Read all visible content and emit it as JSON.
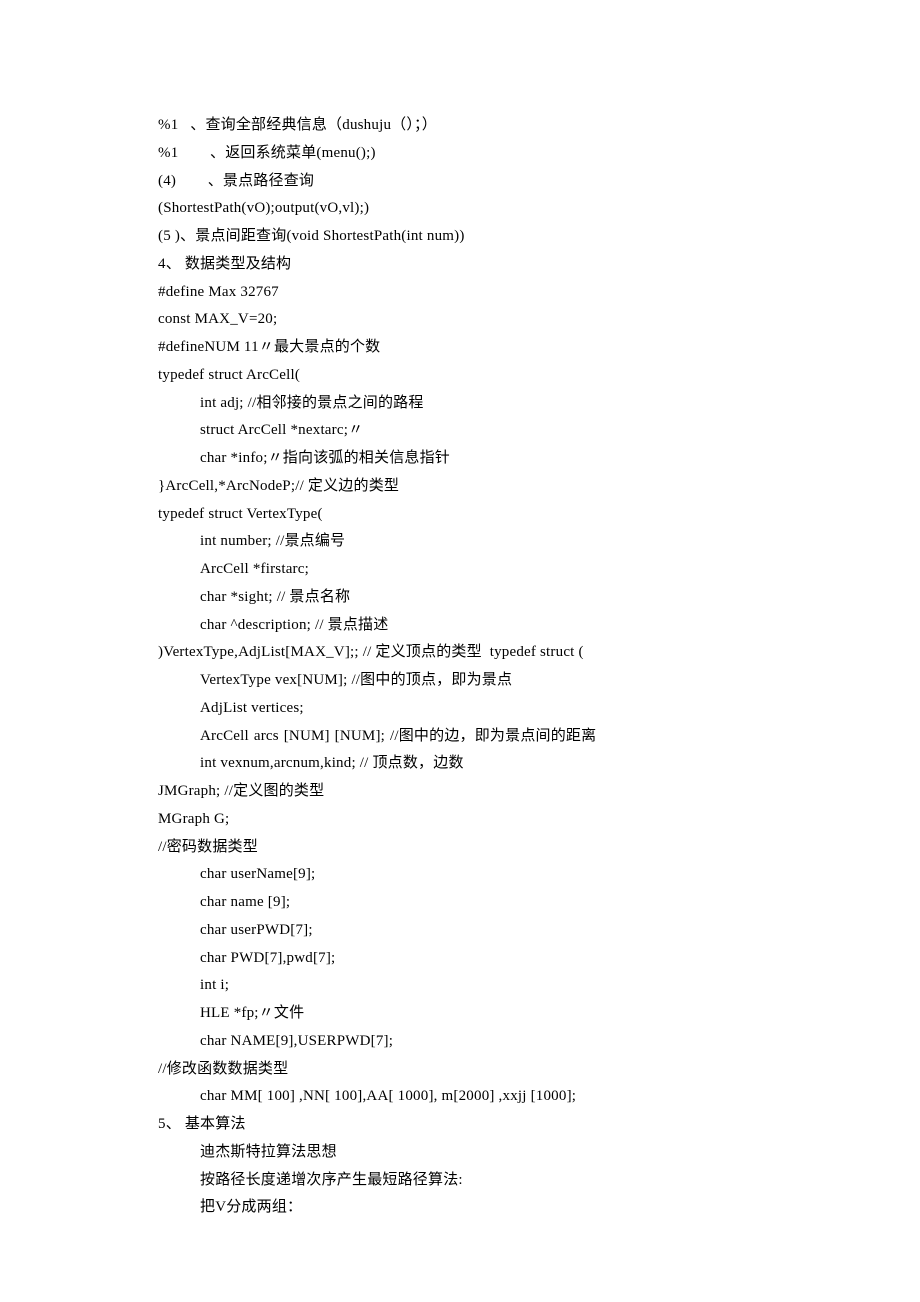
{
  "lines": [
    {
      "cls": "line",
      "text": "%1   、查询全部经典信息（dushuju（）；）"
    },
    {
      "cls": "line",
      "text": "%1        、返回系统菜单(menu();)"
    },
    {
      "cls": "line",
      "text": "(4)        、景点路径查询"
    },
    {
      "cls": "line",
      "text": "(ShortestPath(vO);output(vO,vl);)"
    },
    {
      "cls": "line",
      "text": "(5 )、景点间距查询(void ShortestPath(int num))"
    },
    {
      "cls": "line",
      "text": "4、 数据类型及结构"
    },
    {
      "cls": "line",
      "text": "#define Max 32767"
    },
    {
      "cls": "line",
      "text": "const MAX_V=20;"
    },
    {
      "cls": "line",
      "text": "#defineNUM 11〃最大景点的个数"
    },
    {
      "cls": "line",
      "text": "typedef struct ArcCell("
    },
    {
      "cls": "line indent1",
      "text": "int adj; //相邻接的景点之间的路程"
    },
    {
      "cls": "line indent1",
      "text": "struct ArcCell *nextarc;〃"
    },
    {
      "cls": "line indent1",
      "text": "char *info;〃指向该弧的相关信息指针"
    },
    {
      "cls": "line",
      "text": "}ArcCell,*ArcNodeP;// 定义边的类型"
    },
    {
      "cls": "line",
      "text": "typedef struct VertexType("
    },
    {
      "cls": "line indent1",
      "text": "int number; //景点编号"
    },
    {
      "cls": "line indent1",
      "text": "ArcCell *firstarc;"
    },
    {
      "cls": "line indent1",
      "text": "char *sight; // 景点名称"
    },
    {
      "cls": "line indent1",
      "text": "char ^description; // 景点描述"
    },
    {
      "cls": "line",
      "text": ")VertexType,AdjList[MAX_V];; // 定义顶点的类型  typedef struct ("
    },
    {
      "cls": "line indent1",
      "text": "VertexType vex[NUM]; //图中的顶点，即为景点"
    },
    {
      "cls": "line indent1",
      "text": "AdjList vertices;"
    },
    {
      "cls": "line indent1 widel",
      "text": "ArcCell arcs [NUM] [NUM]; //图中的边，即为景点间的距离"
    },
    {
      "cls": "line indent1",
      "text": "int vexnum,arcnum,kind; // 顶点数，边数"
    },
    {
      "cls": "line",
      "text": "JMGraph; //定义图的类型"
    },
    {
      "cls": "line",
      "text": "MGraph G;"
    },
    {
      "cls": "line",
      "text": "//密码数据类型"
    },
    {
      "cls": "line indent1",
      "text": "char userName[9];"
    },
    {
      "cls": "line indent1",
      "text": "char name [9];"
    },
    {
      "cls": "line indent1",
      "text": "char userPWD[7];"
    },
    {
      "cls": "line indent1",
      "text": "char PWD[7],pwd[7];"
    },
    {
      "cls": "line indent1",
      "text": "int i;"
    },
    {
      "cls": "line indent1",
      "text": "HLE *fp;〃文件"
    },
    {
      "cls": "line indent1",
      "text": "char NAME[9],USERPWD[7];"
    },
    {
      "cls": "line",
      "text": "//修改函数数据类型"
    },
    {
      "cls": "line indent1",
      "text": "char MM[ 100] ,NN[ 100],AA[ 1000], m[2000] ,xxjj [1000];"
    },
    {
      "cls": "line",
      "text": "5、 基本算法"
    },
    {
      "cls": "line",
      "text": ""
    },
    {
      "cls": "line indent1",
      "text": "迪杰斯特拉算法思想"
    },
    {
      "cls": "line indent1",
      "text": "按路径长度递增次序产生最短路径算法:"
    },
    {
      "cls": "line indent1",
      "text": "把V分成两组："
    }
  ]
}
